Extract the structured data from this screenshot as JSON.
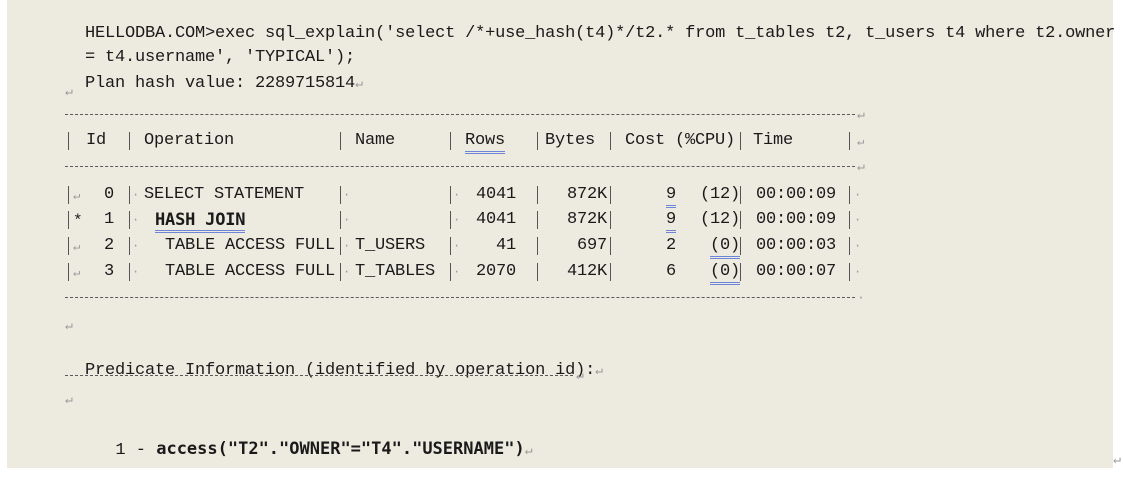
{
  "sql": {
    "line1": "HELLODBA.COM>exec sql_explain('select /*+use_hash(t4)*/t2.* from t_tables t2, t_users t4 where t2.owner",
    "line2": "= t4.username', 'TYPICAL');",
    "plan_hash_label": "Plan hash value: 2289715814"
  },
  "plan": {
    "headers": [
      "Id",
      "Operation",
      "Name",
      "Rows",
      "Bytes",
      "Cost (%CPU)",
      "Time"
    ],
    "rows": [
      {
        "marker": "",
        "id": "0",
        "operation": "SELECT STATEMENT",
        "name": "",
        "rows": "4041",
        "bytes": "872K",
        "cost": "9",
        "cpu": "(12)",
        "time": "00:00:09"
      },
      {
        "marker": "*",
        "id": "1",
        "operation": "HASH JOIN",
        "name": "",
        "rows": "4041",
        "bytes": "872K",
        "cost": "9",
        "cpu": "(12)",
        "time": "00:00:09"
      },
      {
        "marker": "",
        "id": "2",
        "operation": "TABLE ACCESS FULL",
        "name": "T_USERS",
        "rows": "41",
        "bytes": "697",
        "cost": "2",
        "cpu": "(0)",
        "time": "00:00:03"
      },
      {
        "marker": "",
        "id": "3",
        "operation": "TABLE ACCESS FULL",
        "name": "T_TABLES",
        "rows": "2070",
        "bytes": "412K",
        "cost": "6",
        "cpu": "(0)",
        "time": "00:00:07"
      }
    ]
  },
  "predicate": {
    "heading": "Predicate Information (identified by operation id):",
    "id_prefix": "1 - ",
    "expression": "access(\"T2\".\"OWNER\"=\"T4\".\"USERNAME\")"
  },
  "icons": {
    "paragraph_mark": "return-arrow-icon"
  }
}
